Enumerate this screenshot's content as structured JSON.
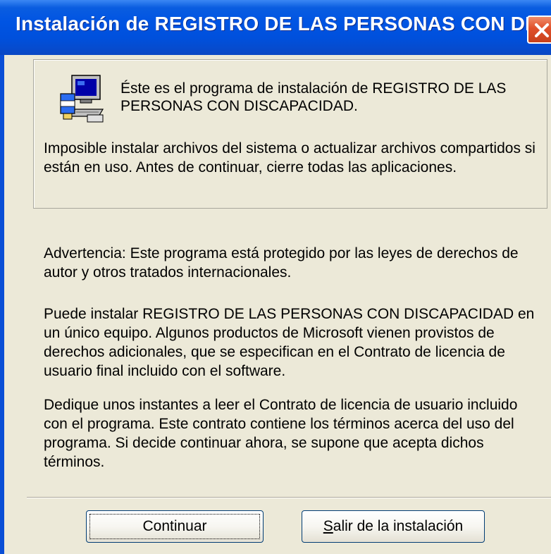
{
  "window": {
    "title": "Instalación de REGISTRO DE LAS PERSONAS CON DISCAP..."
  },
  "header": {
    "intro": "Éste es el programa de instalación de REGISTRO DE LAS PERSONAS CON DISCAPACIDAD.",
    "notice": "Imposible instalar archivos del sistema o actualizar archivos compartidos si están en uso. Antes de continuar, cierre todas las aplicaciones.",
    "icon": "setup-computer-icon"
  },
  "body": {
    "warning": "Advertencia: Este programa está protegido por las leyes de derechos de autor y otros tratados internacionales.",
    "license_info": "Puede instalar REGISTRO DE LAS PERSONAS CON DISCAPACIDAD en un único equipo. Algunos productos de Microsoft vienen provistos de derechos adicionales, que se especifican en el Contrato de licencia de usuario final incluido con el software.",
    "agreement": "Dedique unos instantes a leer el Contrato de licencia de usuario incluido con el programa. Este contrato contiene los términos acerca del uso del programa. Si decide continuar ahora, se supone que acepta dichos términos."
  },
  "buttons": {
    "continue_label": "Continuar",
    "exit_accel": "S",
    "exit_rest": "alir de la instalación"
  },
  "colors": {
    "titlebar": "#0054e3",
    "dialog_bg": "#ece9d8",
    "close": "#e0502a"
  }
}
